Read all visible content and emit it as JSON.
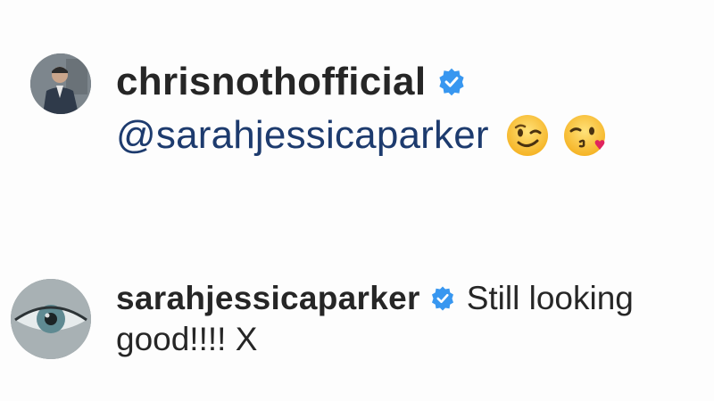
{
  "comments": [
    {
      "username": "chrisnothofficial",
      "verified": true,
      "avatar": "profile-photo-man-in-suit",
      "mention": "@sarahjessicaparker",
      "emojis": [
        "winking-face-emoji",
        "face-blowing-kiss-emoji"
      ]
    },
    {
      "username": "sarahjessicaparker",
      "verified": true,
      "avatar": "profile-photo-eye-closeup",
      "text_line1": "Still looking",
      "text_line2": "good!!!! X"
    }
  ],
  "colors": {
    "username": "#262626",
    "mention": "#1d3b6e",
    "verified_badge": "#3897f0",
    "background": "#fdfdfd"
  }
}
